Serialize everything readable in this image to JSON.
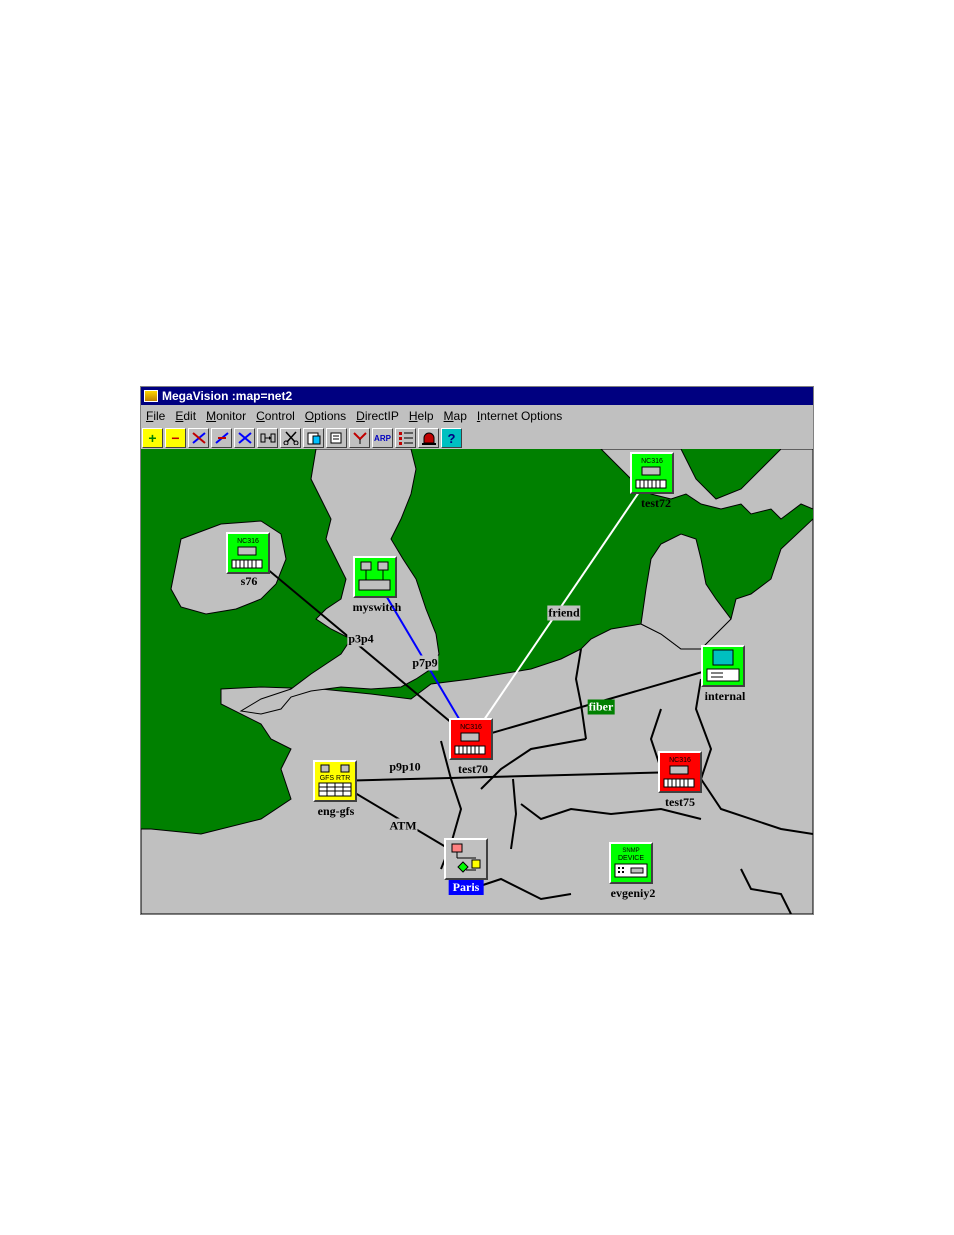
{
  "window": {
    "title": "MegaVision :map=net2"
  },
  "menu": [
    "File",
    "Edit",
    "Monitor",
    "Control",
    "Options",
    "DirectIP",
    "Help",
    "Map",
    "Internet Options"
  ],
  "toolbar": [
    {
      "icon": "add-icon"
    },
    {
      "icon": "remove-icon"
    },
    {
      "icon": "link-icon"
    },
    {
      "icon": "unlink-icon"
    },
    {
      "icon": "cut-link-icon"
    },
    {
      "icon": "goto-icon"
    },
    {
      "icon": "scissors-icon"
    },
    {
      "icon": "clipboard-icon"
    },
    {
      "icon": "edit-icon"
    },
    {
      "icon": "filter-icon"
    },
    {
      "icon": "arp-icon",
      "text": "ARP"
    },
    {
      "icon": "list-icon"
    },
    {
      "icon": "alarm-icon"
    },
    {
      "icon": "help-icon",
      "text": "?"
    }
  ],
  "map": {
    "colors": {
      "sea": "#008000",
      "land": "#c0c0c0",
      "border": "#000000"
    },
    "nodes": [
      {
        "id": "s76",
        "label": "s76",
        "status": "up",
        "color": "#00ff00",
        "badge": "NC316",
        "icon": "hub-icon"
      },
      {
        "id": "myswitch",
        "label": "myswitch",
        "status": "up",
        "color": "#00ff00",
        "badge": "",
        "icon": "switch-icon"
      },
      {
        "id": "test72",
        "label": "test72",
        "status": "up",
        "color": "#00ff00",
        "badge": "NC316",
        "icon": "hub-icon"
      },
      {
        "id": "internal",
        "label": "internal",
        "status": "up",
        "color": "#00ff00",
        "badge": "",
        "icon": "server-icon"
      },
      {
        "id": "test70",
        "label": "test70",
        "status": "down",
        "color": "#ff0000",
        "badge": "NC316",
        "icon": "hub-icon"
      },
      {
        "id": "test75",
        "label": "test75",
        "status": "down",
        "color": "#ff0000",
        "badge": "NC316",
        "icon": "hub-icon"
      },
      {
        "id": "eng-gfs",
        "label": "eng-gfs",
        "status": "warning",
        "color": "#ffff00",
        "badge": "GFS RTR",
        "icon": "router-icon"
      },
      {
        "id": "Paris",
        "label": "Paris",
        "status": "submap",
        "color": "#c0c0c0",
        "badge": "",
        "icon": "submap-icon"
      },
      {
        "id": "evgeniy2",
        "label": "evgeniy2",
        "status": "up",
        "color": "#00ff00",
        "badge": "SNMP DEVICE",
        "icon": "snmp-device-icon"
      }
    ],
    "links": [
      {
        "name": "p3p4",
        "from": "s76",
        "to": "test70",
        "color": "#000000"
      },
      {
        "name": "p7p9",
        "from": "myswitch",
        "to": "test70",
        "color": "#0000ff"
      },
      {
        "name": "friend",
        "from": "test72",
        "to": "test70",
        "color": "#ffffff"
      },
      {
        "name": "fiber",
        "from": "test70",
        "to": "internal",
        "color": "#000000"
      },
      {
        "name": "p9p10",
        "from": "eng-gfs",
        "to": "test75",
        "color": "#000000"
      },
      {
        "name": "ATM",
        "from": "eng-gfs",
        "to": "Paris",
        "color": "#000000"
      }
    ]
  }
}
